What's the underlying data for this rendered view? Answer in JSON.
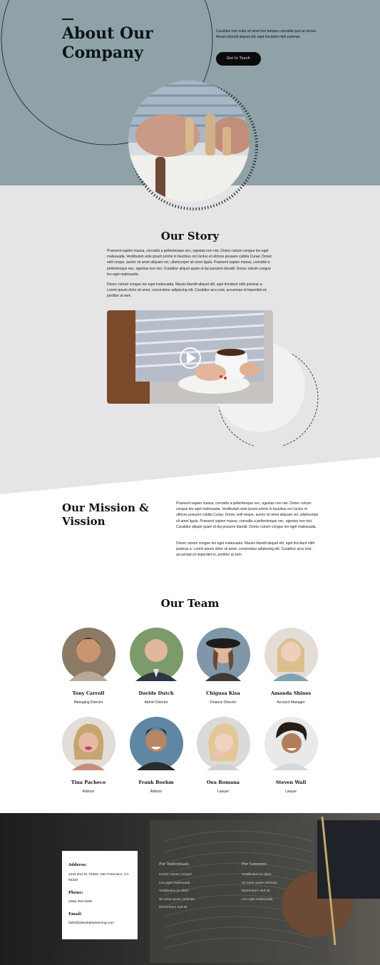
{
  "hero": {
    "title_line1": "About Our",
    "title_line2": "Company",
    "text": "Curabitur non nulla sit amet nisl tempus convallis quis ac lectus. Mauris blandit aliquet elit, eget tincidunt nibh pulvinar.",
    "cta_label": "Get In Touch"
  },
  "story": {
    "title": "Our Story",
    "p1": "Praesent sapien massa, convallis a pellentesque nec, egestas non nisi. Donec rutrum congue leo eget malesuada. Vestibulum ante ipsum primis in faucibus orci luctus et ultrices posuere cubilia Curae; Donec velit neque, auctor sit amet aliquam vel, ullamcorper sit amet ligula. Praesent sapien massa, convallis a pellentesque nec, egestas non nisi. Curabitur aliquet quam id dui posuere blandit. Donec rutrum congue leo eget malesuada.",
    "p2": "Donec rutrum congue leo eget malesuada. Mauris blandit aliquet elit, eget tincidunt nibh pulvinar a. Lorem ipsum dolor sit amet, consectetur adipiscing elit. Curabitur arcu erat, accumsan id imperdiet et, porttitor at sem."
  },
  "mission": {
    "title": "Our Mission & Vission",
    "p1": "Praesent sapien massa, convallis a pellentesque nec, egestas non nisi. Donec rutrum congue leo eget malesuada. Vestibulum ante ipsum primis in faucibus orci luctus et ultrices posuere cubilia Curae; Donec velit neque, auctor sit amet aliquam vel, ullamcorper sit amet ligula. Praesent sapien massa, convallis a pellentesque nec, egestas non nisi. Curabitur aliquet quam id dui posuere blandit. Donec rutrum congue leo eget malesuada.",
    "p2": "Donec rutrum congue leo eget malesuada. Mauris blandit aliquet elit, eget tincidunt nibh pulvinar a. Lorem ipsum dolor sit amet, consectetur adipiscing elit. Curabitur arcu erat, accumsan id imperdiet et, porttitor at sem."
  },
  "team": {
    "title": "Our Team",
    "members": [
      {
        "name": "Tony Carroll",
        "role": "Managing Director"
      },
      {
        "name": "Davide Dutch",
        "role": "Admin Director"
      },
      {
        "name": "Chigusa Kisa",
        "role": "Finance Director"
      },
      {
        "name": "Amanda Shines",
        "role": "Account Manager"
      },
      {
        "name": "Tina Pacheco",
        "role": "Advisor"
      },
      {
        "name": "Frank Boehm",
        "role": "Advisor"
      },
      {
        "name": "Oea Romana",
        "role": "Lawyer"
      },
      {
        "name": "Steven Wall",
        "role": "Lawyer"
      }
    ]
  },
  "footer": {
    "address_label": "Address:",
    "address_value": "1234 Divi St. #1000, San Francisco, CA 94220",
    "phone_label": "Phone:",
    "phone_value": "(255) 352-6258",
    "email_label": "Email:",
    "email_value": "hello@diviestateplanning.com",
    "col1_title": "For Individuals",
    "col1_links": [
      "Donec rutrum congue",
      "Leo eget malesuada",
      "Vestibulum ac diam",
      "Sit amet quam vehicula",
      "Elementum sed sit"
    ],
    "col2_title": "For Lawyers",
    "col2_links": [
      "Vestibulum ac diam",
      "Sit amet quam vehicula",
      "Elementum sed sit",
      "Leo eget malesuada"
    ]
  },
  "colors": {
    "hero_bg": "#8fa2a7",
    "story_bg": "#e5e5e7",
    "cta_bg": "#0b0b0b",
    "accent_red": "#d8323a"
  }
}
